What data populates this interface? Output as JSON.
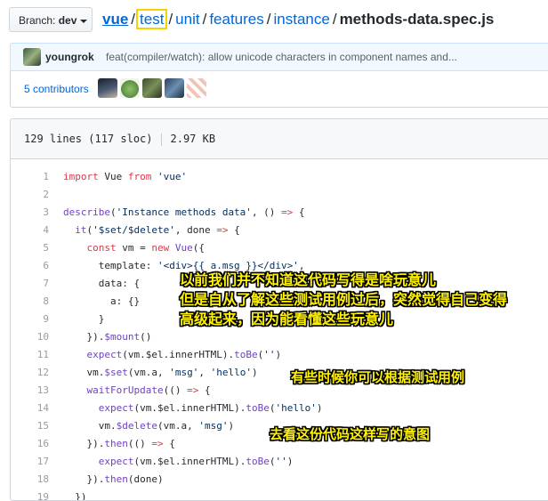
{
  "topbar": {
    "branch_prefix": "Branch:",
    "branch_name": "dev",
    "path": [
      {
        "label": "vue"
      },
      {
        "label": "test"
      },
      {
        "label": "unit"
      },
      {
        "label": "features"
      },
      {
        "label": "instance"
      }
    ],
    "filename": "methods-data.spec.js",
    "separator": "/"
  },
  "commit": {
    "author": "youngrok",
    "message": "feat(compiler/watch): allow unicode characters in component names and..."
  },
  "contributors": {
    "label": "5 contributors",
    "avatars": [
      "avatar-1",
      "avatar-2",
      "avatar-3",
      "avatar-4",
      "avatar-5"
    ]
  },
  "file": {
    "lines_info": "129 lines (117 sloc)",
    "size": "2.97 KB"
  },
  "code": {
    "lines": [
      {
        "n": "1",
        "text": "import Vue from 'vue'"
      },
      {
        "n": "2",
        "text": ""
      },
      {
        "n": "3",
        "text": "describe('Instance methods data', () => {"
      },
      {
        "n": "4",
        "text": "  it('$set/$delete', done => {"
      },
      {
        "n": "5",
        "text": "    const vm = new Vue({"
      },
      {
        "n": "6",
        "text": "      template: '<div>{{ a.msg }}</div>',"
      },
      {
        "n": "7",
        "text": "      data: {"
      },
      {
        "n": "8",
        "text": "        a: {}"
      },
      {
        "n": "9",
        "text": "      }"
      },
      {
        "n": "10",
        "text": "    }).$mount()"
      },
      {
        "n": "11",
        "text": "    expect(vm.$el.innerHTML).toBe('')"
      },
      {
        "n": "12",
        "text": "    vm.$set(vm.a, 'msg', 'hello')"
      },
      {
        "n": "13",
        "text": "    waitForUpdate(() => {"
      },
      {
        "n": "14",
        "text": "      expect(vm.$el.innerHTML).toBe('hello')"
      },
      {
        "n": "15",
        "text": "      vm.$delete(vm.a, 'msg')"
      },
      {
        "n": "16",
        "text": "    }).then(() => {"
      },
      {
        "n": "17",
        "text": "      expect(vm.$el.innerHTML).toBe('')"
      },
      {
        "n": "18",
        "text": "    }).then(done)"
      },
      {
        "n": "19",
        "text": "  })"
      }
    ]
  },
  "annotations": {
    "note1_line1": "以前我们并不知道这代码写得是啥玩意儿",
    "note1_line2": "但是自从了解这些测试用例过后，突然觉得自己变得",
    "note1_line3": "高级起来，因为能看懂这些玩意儿",
    "note2": "有些时候你可以根据测试用例",
    "note3": "去看这份代码这样写的意图",
    "color_text": "#fff200",
    "color_outline": "#000000"
  }
}
